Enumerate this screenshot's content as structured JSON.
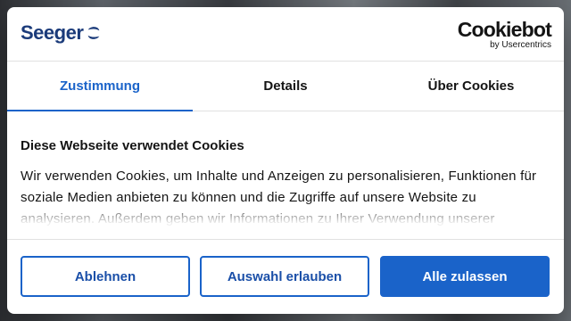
{
  "brand": {
    "name": "Seeger",
    "color": "#1b3b7a"
  },
  "cookiebot": {
    "name": "Cookiebot",
    "sub": "by Usercentrics"
  },
  "tabs": [
    {
      "label": "Zustimmung",
      "active": true
    },
    {
      "label": "Details",
      "active": false
    },
    {
      "label": "Über Cookies",
      "active": false
    }
  ],
  "content": {
    "heading": "Diese Webseite verwendet Cookies",
    "body": "Wir verwenden Cookies, um Inhalte und Anzeigen zu personalisieren, Funktionen für soziale Medien anbieten zu können und die Zugriffe auf unsere Website zu analysieren. Außerdem geben wir Informationen zu Ihrer Verwendung unserer"
  },
  "buttons": {
    "decline": "Ablehnen",
    "allow_selection": "Auswahl erlauben",
    "allow_all": "Alle zulassen"
  },
  "colors": {
    "accent": "#1a63c9",
    "text": "#141414"
  }
}
